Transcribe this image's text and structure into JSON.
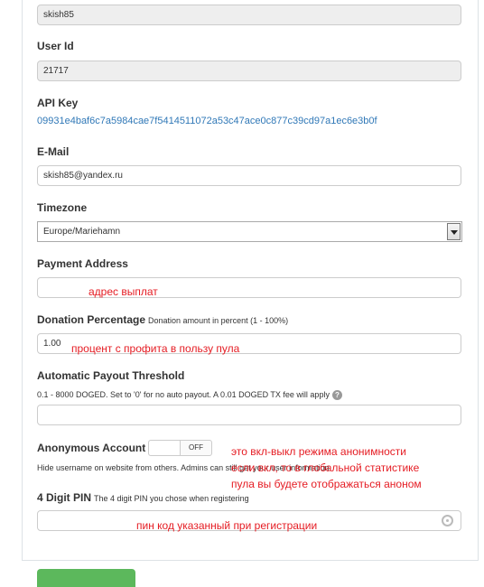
{
  "username": {
    "value": "skish85"
  },
  "userid": {
    "label": "User Id",
    "value": "21717"
  },
  "apikey": {
    "label": "API Key",
    "value": "09931e4baf6c7a5984cae7f5414511072a53c47ace0c877c39cd97a1ec6e3b0f"
  },
  "email": {
    "label": "E-Mail",
    "value": "skish85@yandex.ru"
  },
  "timezone": {
    "label": "Timezone",
    "value": "Europe/Mariehamn"
  },
  "payment": {
    "label": "Payment Address",
    "value": "",
    "note": "адрес выплат"
  },
  "donation": {
    "label": "Donation Percentage",
    "sublabel": "Donation amount in percent (1 - 100%)",
    "value": "1.00",
    "note": "процент с профита в пользу пула"
  },
  "payout": {
    "label": "Automatic Payout Threshold",
    "help": "0.1 - 8000 DOGED. Set to '0' for no auto payout. A 0.01 DOGED TX fee will apply",
    "value": ""
  },
  "anon": {
    "label": "Anonymous Account",
    "toggle_state": "OFF",
    "help": "Hide username on website from others. Admins can still get your user information.",
    "note_lines": [
      "это вкл-выкл режима анонимности",
      "если вкл, то в глобальной статистике",
      "пула вы будете отображаться аноном"
    ]
  },
  "pin": {
    "label": "4 Digit PIN",
    "sublabel": "The 4 digit PIN you chose when registering",
    "value": "",
    "note": "пин код указанный при регистрации"
  }
}
